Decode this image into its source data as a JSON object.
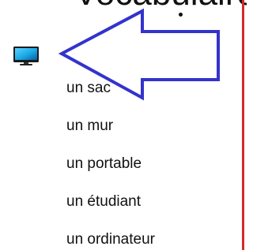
{
  "header": {
    "cut_title": "Vocabulaire"
  },
  "list": {
    "items": [
      {
        "label": "un sac"
      },
      {
        "label": "un mur"
      },
      {
        "label": "un portable"
      },
      {
        "label": "un étudiant"
      },
      {
        "label": "un ordinateur"
      }
    ]
  },
  "icons": {
    "monitor": "monitor-icon",
    "arrow": "left-arrow-icon"
  },
  "colors": {
    "arrow_stroke": "#3333cc",
    "edge_line": "#d42a2a",
    "monitor_screen": "#1aa7e6"
  }
}
